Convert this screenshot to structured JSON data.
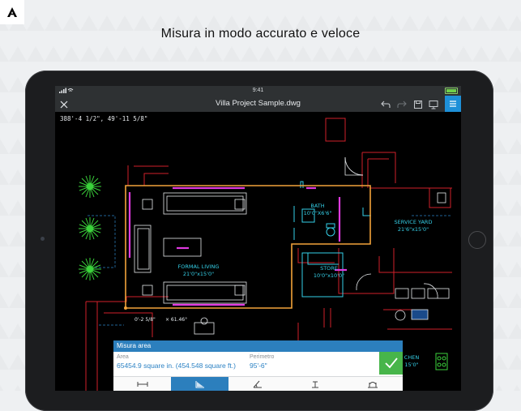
{
  "headline": "Misura in modo accurato e veloce",
  "statusbar": {
    "time": "9:41"
  },
  "toolbar": {
    "title": "Villa Project Sample.dwg"
  },
  "coordinates": "388'-4 1/2\",   49'-11 5/8\"",
  "rooms": {
    "bath": {
      "name": "BATH",
      "size": "10'0\"X6'6\""
    },
    "service_yard": {
      "name": "SERVICE YARD",
      "size": "21'6\"x15'0\""
    },
    "formal_living": {
      "name": "FORMAL LIVING",
      "size": "21'0\"x15'0\""
    },
    "store": {
      "name": "STORE",
      "size": "10'0\"x10'0\""
    },
    "kitchen": {
      "name": "CHEN",
      "size": "15'0\""
    }
  },
  "measure_labels": {
    "left": "0'-2 5/8\"",
    "right": "× 61.46°"
  },
  "measure_panel": {
    "title": "Misura area",
    "area_label": "Area",
    "area_value": "65454.9 square in. (454.548 square ft.)",
    "perimeter_label": "Perimetro",
    "perimeter_value": "95'-6\""
  },
  "icons": {
    "brand": "autodesk-logo-icon",
    "close": "close-icon",
    "undo": "undo-icon",
    "redo": "redo-icon",
    "save": "save-icon",
    "present": "presentation-icon",
    "menu": "menu-icon",
    "confirm": "checkmark-icon",
    "tools": [
      "measure-distance-icon",
      "measure-area-icon",
      "measure-angle-icon",
      "measure-radius-icon",
      "measure-arc-icon"
    ]
  },
  "colors": {
    "toolbar_bg": "#2e3133",
    "accent_blue": "#2c7fbd",
    "confirm_green": "#47b54a",
    "selection_orange": "#f2a33a",
    "cad_cyan": "#35d0e8",
    "cad_red": "#d0202a",
    "cad_magenta": "#e03ae0",
    "cad_green": "#3bd23b"
  }
}
